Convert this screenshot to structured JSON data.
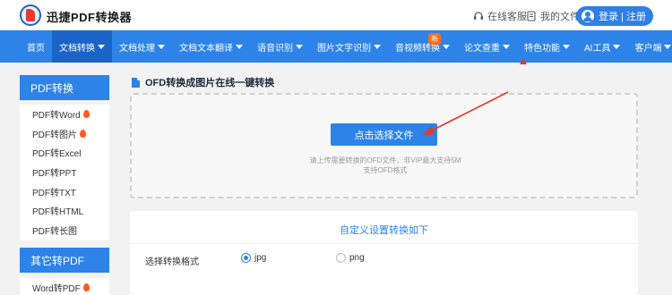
{
  "header": {
    "app_name": "迅捷PDF转换器",
    "links": [
      {
        "label": "在线客服",
        "icon": "headset-icon"
      },
      {
        "label": "我的文件",
        "icon": "file-icon"
      }
    ],
    "login_label": "登录 | 注册"
  },
  "nav": {
    "items": [
      {
        "label": "首页",
        "caret": false
      },
      {
        "label": "文档转换",
        "caret": true,
        "active": true
      },
      {
        "label": "文档处理",
        "caret": true
      },
      {
        "label": "文档文本翻译",
        "caret": true
      },
      {
        "label": "语音识别",
        "caret": true
      },
      {
        "label": "图片文字识别",
        "caret": true
      },
      {
        "label": "音视频转换",
        "caret": true
      },
      {
        "label": "论文查重",
        "caret": true
      },
      {
        "label": "特色功能",
        "caret": true
      },
      {
        "label": "AI工具",
        "caret": true
      },
      {
        "label": "客户端",
        "caret": true
      }
    ],
    "new_badge": "新"
  },
  "sidebar": {
    "group1_title": "PDF转换",
    "group1_items": [
      {
        "label": "PDF转Word",
        "hot": true
      },
      {
        "label": "PDF转图片",
        "hot": true
      },
      {
        "label": "PDF转Excel",
        "hot": false
      },
      {
        "label": "PDF转PPT",
        "hot": false
      },
      {
        "label": "PDF转TXT",
        "hot": false
      },
      {
        "label": "PDF转HTML",
        "hot": false
      },
      {
        "label": "PDF转长图",
        "hot": false
      }
    ],
    "group2_title": "其它转PDF",
    "group2_items": [
      {
        "label": "Word转PDF",
        "hot": true
      }
    ]
  },
  "main": {
    "title": "OFD转换成图片在线一键转换",
    "choose_button": "点击选择文件",
    "hint_line1": "请上传需要转换的OFD文件，非VIP最大支持5M",
    "hint_line2": "支持OFD格式"
  },
  "settings": {
    "title": "自定义设置转换如下",
    "format_label": "选择转换格式",
    "options": [
      {
        "label": "jpg",
        "checked": true
      },
      {
        "label": "png",
        "checked": false
      }
    ]
  },
  "colors": {
    "accent": "#2d83e8",
    "nav_active": "#1b64c7",
    "arrow": "#e03b2f"
  }
}
